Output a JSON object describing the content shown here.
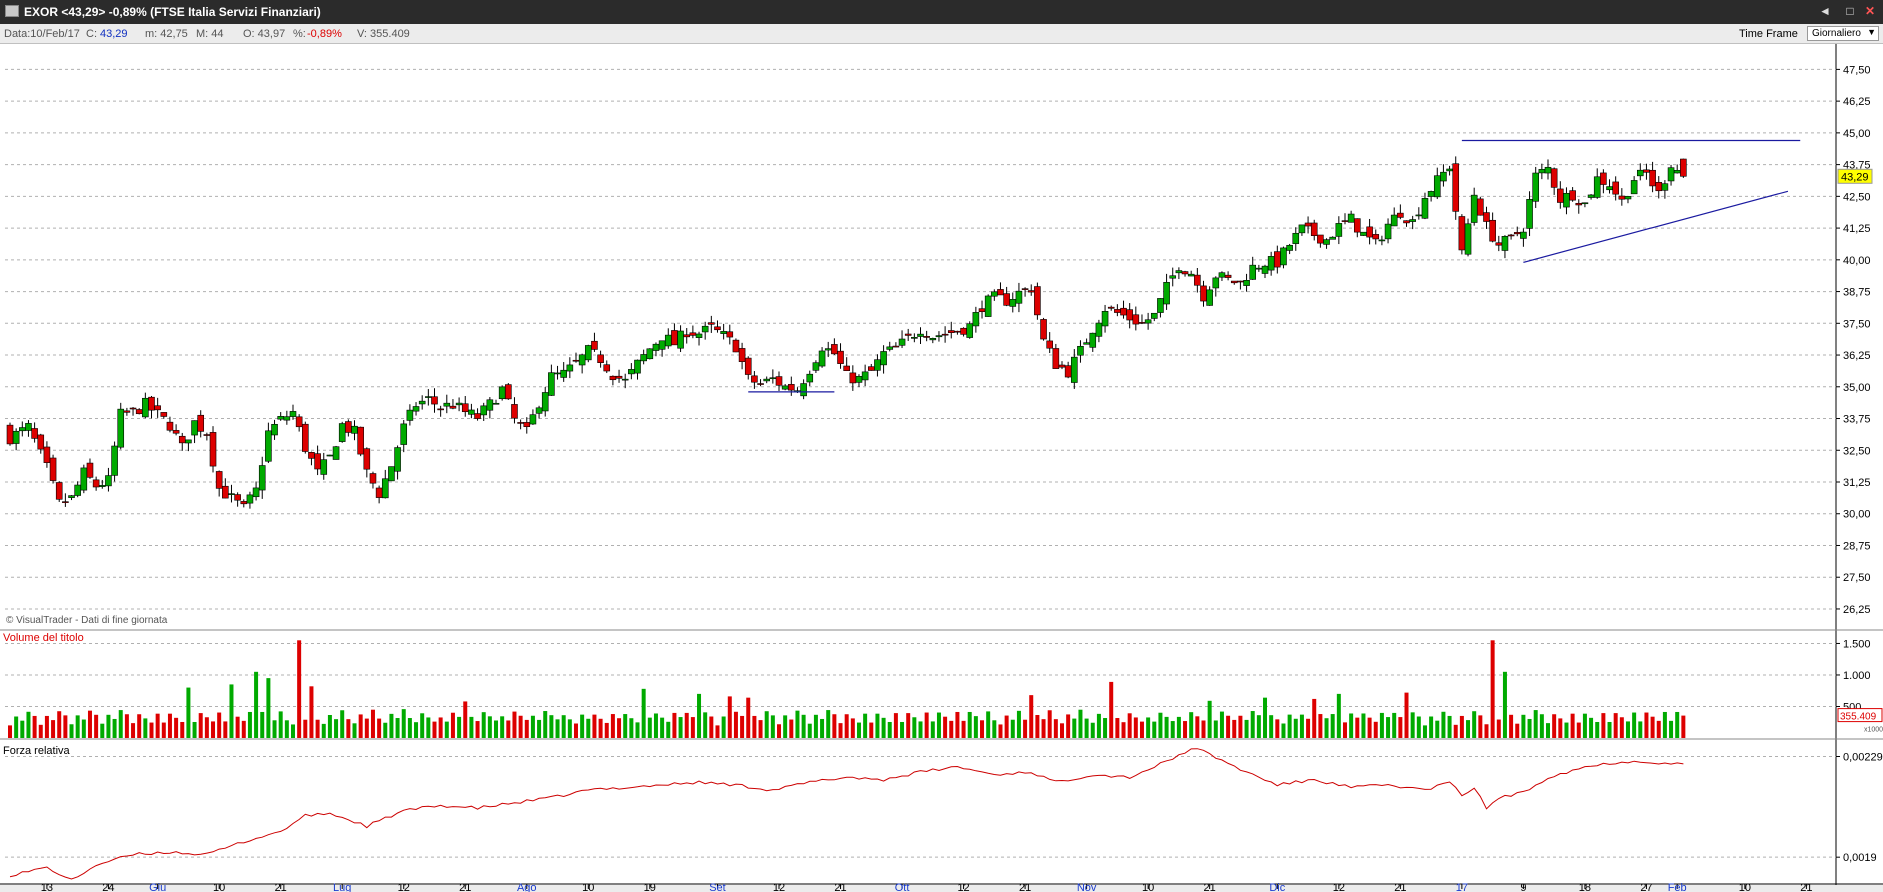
{
  "window": {
    "title": "EXOR <43,29> -0,89%  (FTSE Italia Servizi Finanziari)",
    "buttons": [
      "◄",
      "□",
      "✕"
    ]
  },
  "infobar": {
    "date": "Data:10/Feb/17",
    "close_label": "C:",
    "close_value": "43,29",
    "low": "m: 42,75",
    "high": "M: 44",
    "open": "O: 43,97",
    "pct_label": "%:",
    "pct_value": "-0,89%",
    "volume": "V: 355.409",
    "timeframe_label": "Time Frame",
    "timeframe_value": "Giornaliero"
  },
  "colors": {
    "up": "#00aa00",
    "down": "#dd0000",
    "line": "#cc0000",
    "trendline": "#1a1aa0",
    "grid": "#b0b0b0",
    "last_price_bg": "#ffff00"
  },
  "chart_data": [
    {
      "type": "candlestick",
      "title": "",
      "watermark": "© VisualTrader - Dati di fine giornata",
      "ylim": [
        25.5,
        48.5
      ],
      "y_ticks": [
        "47,50",
        "46,25",
        "45,00",
        "43,75",
        "42,50",
        "41,25",
        "40,00",
        "38,75",
        "37,50",
        "36,25",
        "35,00",
        "33,75",
        "32,50",
        "31,25",
        "30,00",
        "28,75",
        "27,50",
        "26,25"
      ],
      "y_tick_values": [
        47.5,
        46.25,
        45,
        43.75,
        42.5,
        41.25,
        40,
        38.75,
        37.5,
        36.25,
        35,
        33.75,
        32.5,
        31.25,
        30,
        28.75,
        27.5,
        26.25
      ],
      "last_price": "43,29",
      "x_labels": [
        {
          "i": 6,
          "text": "13",
          "month": false
        },
        {
          "i": 16,
          "text": "24",
          "month": false
        },
        {
          "i": 24,
          "text": "Giu",
          "month": true
        },
        {
          "i": 34,
          "text": "10",
          "month": false
        },
        {
          "i": 44,
          "text": "21",
          "month": false
        },
        {
          "i": 54,
          "text": "Lug",
          "month": true
        },
        {
          "i": 64,
          "text": "12",
          "month": false
        },
        {
          "i": 74,
          "text": "21",
          "month": false
        },
        {
          "i": 84,
          "text": "Ago",
          "month": true
        },
        {
          "i": 94,
          "text": "10",
          "month": false
        },
        {
          "i": 104,
          "text": "19",
          "month": false
        },
        {
          "i": 115,
          "text": "Set",
          "month": true
        },
        {
          "i": 125,
          "text": "12",
          "month": false
        },
        {
          "i": 135,
          "text": "21",
          "month": false
        },
        {
          "i": 145,
          "text": "Ott",
          "month": true
        },
        {
          "i": 155,
          "text": "12",
          "month": false
        },
        {
          "i": 165,
          "text": "21",
          "month": false
        },
        {
          "i": 175,
          "text": "Nov",
          "month": true
        },
        {
          "i": 185,
          "text": "10",
          "month": false
        },
        {
          "i": 195,
          "text": "21",
          "month": false
        },
        {
          "i": 206,
          "text": "Dic",
          "month": true
        },
        {
          "i": 216,
          "text": "12",
          "month": false
        },
        {
          "i": 226,
          "text": "21",
          "month": false
        },
        {
          "i": 236,
          "text": "17",
          "month": true
        },
        {
          "i": 246,
          "text": "9",
          "month": false
        },
        {
          "i": 256,
          "text": "18",
          "month": false
        },
        {
          "i": 266,
          "text": "27",
          "month": false
        },
        {
          "i": 271,
          "text": "Feb",
          "month": true
        },
        {
          "i": 282,
          "text": "10",
          "month": false
        },
        {
          "i": 292,
          "text": "21",
          "month": false
        }
      ],
      "waypoints": [
        [
          0,
          33.0
        ],
        [
          3,
          33.4
        ],
        [
          6,
          31.8
        ],
        [
          8,
          30.4
        ],
        [
          10,
          30.6
        ],
        [
          12,
          31.6
        ],
        [
          14,
          31.1
        ],
        [
          16,
          31.3
        ],
        [
          18,
          33.9
        ],
        [
          20,
          34.0
        ],
        [
          22,
          34.3
        ],
        [
          24,
          33.9
        ],
        [
          26,
          33.5
        ],
        [
          28,
          32.6
        ],
        [
          30,
          33.6
        ],
        [
          32,
          33.2
        ],
        [
          34,
          31.0
        ],
        [
          36,
          30.6
        ],
        [
          38,
          30.2
        ],
        [
          40,
          30.9
        ],
        [
          42,
          33.2
        ],
        [
          44,
          33.7
        ],
        [
          46,
          34.0
        ],
        [
          48,
          32.6
        ],
        [
          50,
          31.6
        ],
        [
          52,
          32.2
        ],
        [
          54,
          33.5
        ],
        [
          56,
          33.2
        ],
        [
          58,
          31.6
        ],
        [
          60,
          30.8
        ],
        [
          62,
          31.9
        ],
        [
          64,
          33.4
        ],
        [
          66,
          34.3
        ],
        [
          68,
          34.5
        ],
        [
          70,
          34.2
        ],
        [
          72,
          34.3
        ],
        [
          74,
          34.0
        ],
        [
          76,
          33.8
        ],
        [
          78,
          34.3
        ],
        [
          80,
          34.9
        ],
        [
          82,
          33.7
        ],
        [
          84,
          33.2
        ],
        [
          86,
          34.4
        ],
        [
          88,
          35.4
        ],
        [
          90,
          35.5
        ],
        [
          92,
          35.9
        ],
        [
          94,
          36.4
        ],
        [
          96,
          36.1
        ],
        [
          98,
          35.5
        ],
        [
          100,
          35.2
        ],
        [
          102,
          35.9
        ],
        [
          104,
          36.5
        ],
        [
          106,
          37.0
        ],
        [
          108,
          36.7
        ],
        [
          110,
          37.2
        ],
        [
          112,
          37.1
        ],
        [
          114,
          37.3
        ],
        [
          116,
          37.0
        ],
        [
          118,
          36.6
        ],
        [
          120,
          35.3
        ],
        [
          122,
          35.1
        ],
        [
          124,
          35.3
        ],
        [
          126,
          35.0
        ],
        [
          128,
          34.9
        ],
        [
          130,
          35.7
        ],
        [
          132,
          36.6
        ],
        [
          134,
          36.3
        ],
        [
          136,
          35.4
        ],
        [
          138,
          35.3
        ],
        [
          140,
          35.6
        ],
        [
          142,
          36.3
        ],
        [
          144,
          36.5
        ],
        [
          146,
          36.9
        ],
        [
          148,
          37.3
        ],
        [
          150,
          37.0
        ],
        [
          152,
          37.1
        ],
        [
          154,
          37.2
        ],
        [
          156,
          37.4
        ],
        [
          158,
          38.2
        ],
        [
          160,
          38.5
        ],
        [
          162,
          38.4
        ],
        [
          164,
          38.7
        ],
        [
          166,
          38.9
        ],
        [
          168,
          36.8
        ],
        [
          170,
          35.9
        ],
        [
          172,
          35.6
        ],
        [
          174,
          36.4
        ],
        [
          176,
          37.3
        ],
        [
          178,
          38.1
        ],
        [
          180,
          37.9
        ],
        [
          182,
          37.7
        ],
        [
          184,
          37.5
        ],
        [
          186,
          37.8
        ],
        [
          188,
          38.9
        ],
        [
          190,
          39.8
        ],
        [
          192,
          39.5
        ],
        [
          194,
          38.6
        ],
        [
          196,
          39.4
        ],
        [
          198,
          39.2
        ],
        [
          200,
          39.1
        ],
        [
          202,
          39.7
        ],
        [
          204,
          39.9
        ],
        [
          206,
          39.9
        ],
        [
          208,
          40.6
        ],
        [
          210,
          41.2
        ],
        [
          212,
          41.0
        ],
        [
          214,
          40.8
        ],
        [
          216,
          41.3
        ],
        [
          218,
          41.6
        ],
        [
          220,
          41.0
        ],
        [
          222,
          40.6
        ],
        [
          224,
          41.4
        ],
        [
          226,
          41.9
        ],
        [
          228,
          41.5
        ],
        [
          230,
          42.5
        ],
        [
          232,
          43.1
        ],
        [
          234,
          43.7
        ],
        [
          236,
          40.2
        ],
        [
          238,
          42.6
        ],
        [
          240,
          41.3
        ],
        [
          242,
          40.6
        ],
        [
          244,
          40.8
        ],
        [
          246,
          41.3
        ],
        [
          248,
          43.3
        ],
        [
          250,
          43.6
        ],
        [
          252,
          42.4
        ],
        [
          254,
          42.6
        ],
        [
          256,
          42.2
        ],
        [
          258,
          43.2
        ],
        [
          260,
          43.0
        ],
        [
          262,
          42.3
        ],
        [
          264,
          43.2
        ],
        [
          266,
          43.4
        ],
        [
          268,
          42.6
        ],
        [
          270,
          43.8
        ],
        [
          272,
          43.29
        ]
      ],
      "volume": {
        "label": "Volume del titolo",
        "ylim": [
          0,
          1650000
        ],
        "y_ticks": [
          "1.500",
          "1.000",
          "500"
        ],
        "y_tick_values": [
          1500000,
          1000000,
          500000
        ],
        "last_value": "355.409",
        "scale_note": "x1000",
        "peaks": [
          [
            29,
            800000
          ],
          [
            36,
            850000
          ],
          [
            40,
            1050000
          ],
          [
            42,
            950000
          ],
          [
            47,
            1550000
          ],
          [
            49,
            820000
          ],
          [
            74,
            580000
          ],
          [
            103,
            780000
          ],
          [
            112,
            700000
          ],
          [
            117,
            660000
          ],
          [
            120,
            640000
          ],
          [
            166,
            680000
          ],
          [
            179,
            890000
          ],
          [
            195,
            590000
          ],
          [
            204,
            640000
          ],
          [
            212,
            620000
          ],
          [
            216,
            700000
          ],
          [
            227,
            720000
          ],
          [
            241,
            1550000
          ],
          [
            243,
            1050000
          ]
        ]
      },
      "relative_strength": {
        "label": "Forza relativa",
        "ylim": [
          0.0018,
          0.00235
        ],
        "y_ticks": [
          "0,00229",
          "0,0019"
        ],
        "y_tick_values": [
          0.00229,
          0.0019
        ],
        "waypoints": [
          [
            0,
            0.00183
          ],
          [
            6,
            0.00186
          ],
          [
            10,
            0.00181
          ],
          [
            14,
            0.00187
          ],
          [
            20,
            0.00191
          ],
          [
            26,
            0.00192
          ],
          [
            32,
            0.00191
          ],
          [
            38,
            0.00196
          ],
          [
            44,
            0.002
          ],
          [
            48,
            0.00206
          ],
          [
            52,
            0.00207
          ],
          [
            58,
            0.00202
          ],
          [
            64,
            0.00208
          ],
          [
            70,
            0.0021
          ],
          [
            76,
            0.00209
          ],
          [
            82,
            0.00211
          ],
          [
            88,
            0.00213
          ],
          [
            94,
            0.00216
          ],
          [
            100,
            0.00217
          ],
          [
            106,
            0.00218
          ],
          [
            112,
            0.00219
          ],
          [
            118,
            0.00218
          ],
          [
            124,
            0.00216
          ],
          [
            130,
            0.00219
          ],
          [
            136,
            0.00221
          ],
          [
            142,
            0.0022
          ],
          [
            148,
            0.00223
          ],
          [
            154,
            0.00225
          ],
          [
            160,
            0.00222
          ],
          [
            166,
            0.00223
          ],
          [
            170,
            0.00219
          ],
          [
            176,
            0.00222
          ],
          [
            182,
            0.00221
          ],
          [
            188,
            0.00227
          ],
          [
            192,
            0.00232
          ],
          [
            194,
            0.00231
          ],
          [
            200,
            0.00224
          ],
          [
            206,
            0.00218
          ],
          [
            212,
            0.0022
          ],
          [
            218,
            0.00217
          ],
          [
            224,
            0.00218
          ],
          [
            230,
            0.00216
          ],
          [
            234,
            0.00219
          ],
          [
            236,
            0.00214
          ],
          [
            238,
            0.00217
          ],
          [
            240,
            0.00209
          ],
          [
            242,
            0.00213
          ],
          [
            246,
            0.00215
          ],
          [
            250,
            0.00221
          ],
          [
            256,
            0.00225
          ],
          [
            262,
            0.00227
          ],
          [
            266,
            0.00227
          ],
          [
            272,
            0.00226
          ]
        ]
      }
    }
  ]
}
